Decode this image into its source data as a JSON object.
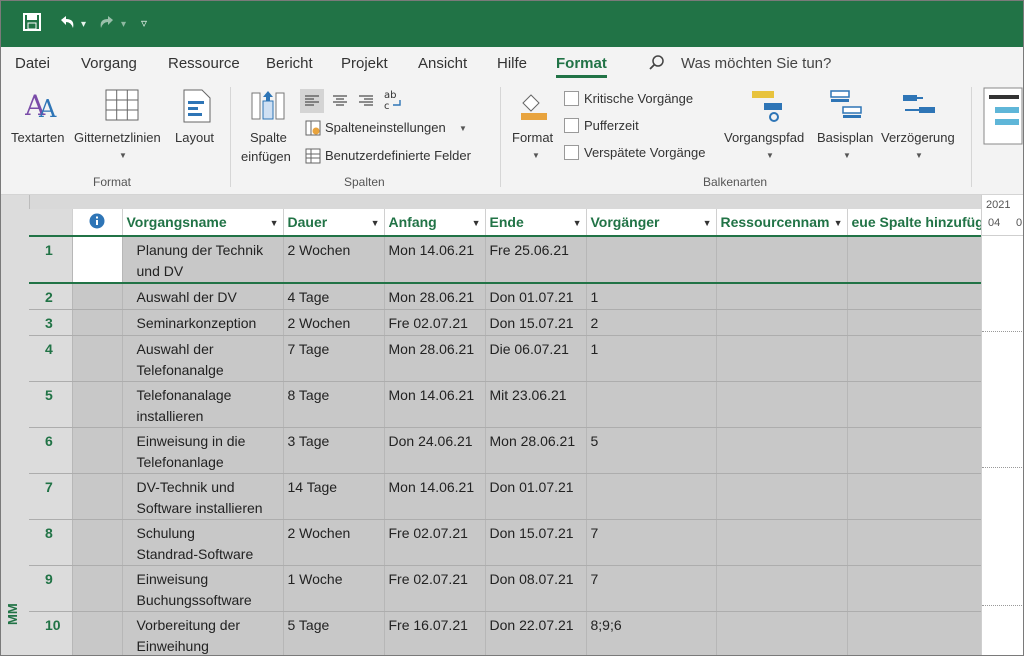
{
  "qat": {
    "save_icon": "save-icon",
    "undo_icon": "undo-icon",
    "redo_icon": "redo-icon",
    "customize_icon": "customize-icon"
  },
  "menu": {
    "items": [
      "Datei",
      "Vorgang",
      "Ressource",
      "Bericht",
      "Projekt",
      "Ansicht",
      "Hilfe",
      "Format"
    ],
    "active": "Format",
    "search_placeholder": "Was möchten Sie tun?"
  },
  "ribbon": {
    "format_group": {
      "textarten": "Textarten",
      "gitternetzlinien": "Gitternetzlinien",
      "layout": "Layout",
      "label": "Format"
    },
    "spalten_group": {
      "spalte_line1": "Spalte",
      "spalte_line2": "einfügen",
      "spalteneinstellungen": "Spalteneinstellungen",
      "benutzerdefinierte": "Benutzerdefinierte Felder",
      "label": "Spalten"
    },
    "balkenarten_group": {
      "format": "Format",
      "kritische": "Kritische Vorgänge",
      "pufferzeit": "Pufferzeit",
      "verspaetete": "Verspätete Vorgänge",
      "vorgangspfad": "Vorgangspfad",
      "basisplan": "Basisplan",
      "verzoegerung": "Verzögerung",
      "label": "Balkenarten"
    }
  },
  "table": {
    "headers": [
      "Vorgangsname",
      "Dauer",
      "Anfang",
      "Ende",
      "Vorgänger",
      "Ressourcennam",
      "eue Spalte hinzufüg"
    ],
    "rows": [
      {
        "id": "1",
        "name1": "Planung der Technik",
        "name2": "und DV",
        "dauer": "2 Wochen",
        "anfang": "Mon 14.06.21",
        "ende": "Fre 25.06.21",
        "vorg": ""
      },
      {
        "id": "2",
        "name1": "Auswahl der DV",
        "name2": "",
        "dauer": "4 Tage",
        "anfang": "Mon 28.06.21",
        "ende": "Don 01.07.21",
        "vorg": "1"
      },
      {
        "id": "3",
        "name1": "Seminarkonzeption",
        "name2": "",
        "dauer": "2 Wochen",
        "anfang": "Fre 02.07.21",
        "ende": "Don 15.07.21",
        "vorg": "2"
      },
      {
        "id": "4",
        "name1": "Auswahl der",
        "name2": "Telefonanalge",
        "dauer": "7 Tage",
        "anfang": "Mon 28.06.21",
        "ende": "Die 06.07.21",
        "vorg": "1"
      },
      {
        "id": "5",
        "name1": "Telefonanalage",
        "name2": "installieren",
        "dauer": "8 Tage",
        "anfang": "Mon 14.06.21",
        "ende": "Mit 23.06.21",
        "vorg": ""
      },
      {
        "id": "6",
        "name1": "Einweisung in die",
        "name2": "Telefonanlage",
        "dauer": "3 Tage",
        "anfang": "Don 24.06.21",
        "ende": "Mon 28.06.21",
        "vorg": "5"
      },
      {
        "id": "7",
        "name1": "DV-Technik und",
        "name2": "Software installieren",
        "dauer": "14 Tage",
        "anfang": "Mon 14.06.21",
        "ende": "Don 01.07.21",
        "vorg": ""
      },
      {
        "id": "8",
        "name1": "Schulung",
        "name2": "Standrad-Software",
        "dauer": "2 Wochen",
        "anfang": "Fre 02.07.21",
        "ende": "Don 15.07.21",
        "vorg": "7"
      },
      {
        "id": "9",
        "name1": "Einweisung",
        "name2": "Buchungssoftware",
        "dauer": "1 Woche",
        "anfang": "Fre 02.07.21",
        "ende": "Don 08.07.21",
        "vorg": "7"
      },
      {
        "id": "10",
        "name1": "Vorbereitung der",
        "name2": "Einweihung",
        "dauer": "5 Tage",
        "anfang": "Fre 16.07.21",
        "ende": "Don 22.07.21",
        "vorg": "8;9;6"
      }
    ]
  },
  "gantt": {
    "year": "2021",
    "week": "04",
    "week2": "0"
  },
  "sidebar": {
    "label": "MM"
  },
  "colors": {
    "accent": "#217346",
    "grid_bg": "#c8c8c8"
  }
}
